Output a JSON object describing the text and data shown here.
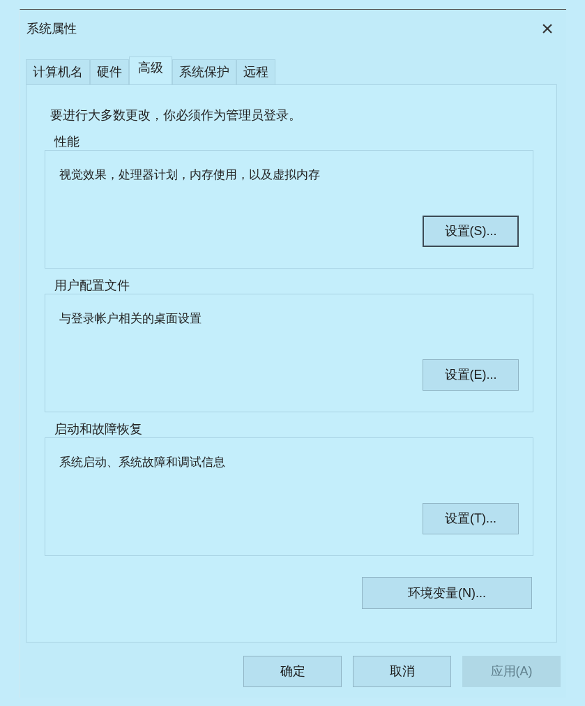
{
  "window": {
    "title": "系统属性",
    "close": "×"
  },
  "tabs": [
    {
      "label": "计算机名",
      "selected": false
    },
    {
      "label": "硬件",
      "selected": false
    },
    {
      "label": "高级",
      "selected": true
    },
    {
      "label": "系统保护",
      "selected": false
    },
    {
      "label": "远程",
      "selected": false
    }
  ],
  "notice": "要进行大多数更改，你必须作为管理员登录。",
  "groups": [
    {
      "title": "性能",
      "description": "视觉效果，处理器计划，内存使用，以及虚拟内存",
      "button": {
        "label": "设置(S)...",
        "focused": true
      }
    },
    {
      "title": "用户配置文件",
      "description": "与登录帐户相关的桌面设置",
      "button": {
        "label": "设置(E)...",
        "focused": false
      }
    },
    {
      "title": "启动和故障恢复",
      "description": "系统启动、系统故障和调试信息",
      "button": {
        "label": "设置(T)...",
        "focused": false
      }
    }
  ],
  "env_button": {
    "label": "环境变量(N)...",
    "focused": false
  },
  "buttons": [
    {
      "label": "确定",
      "disabled": false
    },
    {
      "label": "取消",
      "disabled": false
    },
    {
      "label": "应用(A)",
      "disabled": true
    }
  ]
}
